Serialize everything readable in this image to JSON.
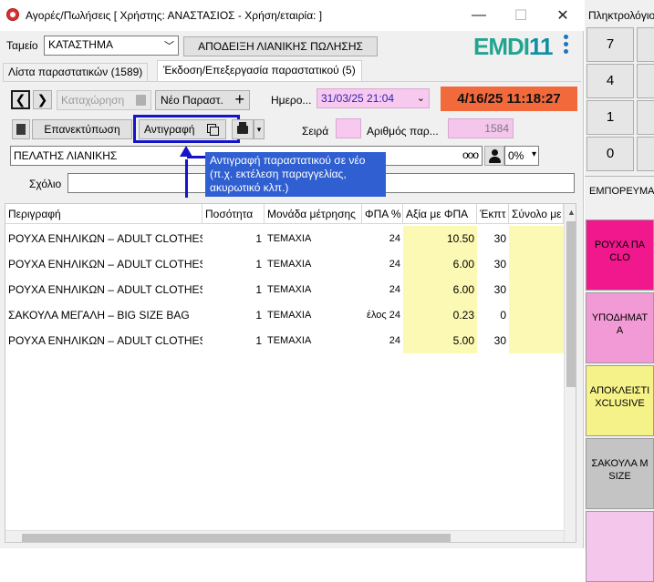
{
  "window": {
    "title": "Αγορές/Πωλήσεις  [ Χρήστης: ΑΝΑΣΤΑΣΙΟΣ - Χρήση/εταιρία:  ]",
    "minimize": "—",
    "maximize": "☐",
    "close": "✕"
  },
  "register": {
    "label": "Ταμείο",
    "value": "ΚΑΤΑΣΤΗΜΑ"
  },
  "doc_type_button": "ΑΠΟΔΕΙΞΗ ΛΙΑΝΙΚΗΣ ΠΩΛΗΣΗΣ",
  "logo": {
    "text": "EMDI",
    "number": "11"
  },
  "tabs": [
    {
      "label": "Λίστα παραστατικών (1589)"
    },
    {
      "label": "Έκδοση/Επεξεργασία παραστατικού (5)"
    }
  ],
  "toolbar": {
    "prev_icon": "❮",
    "next_icon": "❯",
    "save_label": "Καταχώρηση",
    "new_doc_label": "Νέο Παραστ.",
    "new_doc_icon": "+",
    "date_label": "Ημερο...",
    "date_value": "31/03/25 21:04",
    "clock": "4/16/25 11:18:27",
    "reprint_label": "Επανεκτύπωση",
    "copy_label": "Αντιγραφή",
    "print_dropdown": "▾",
    "series_label": "Σειρά",
    "series_value": "",
    "docnum_label": "Αριθμός παρ...",
    "docnum_value": "1584"
  },
  "customer": {
    "value": "ΠΕΛΑΤΗΣ ΛΙΑΝΙΚΗΣ",
    "dots": "ooo",
    "discount": "0%"
  },
  "comment": {
    "label": "Σχόλιο",
    "value": ""
  },
  "tooltip": "Αντιγραφή παραστατικού σε νέο (π.χ. εκτέλεση παραγγελίας, ακυρωτικό κλπ.)",
  "grid": {
    "headers": [
      "Περιγραφή",
      "Ποσότητα",
      "Μονάδα μέτρησης",
      "ΦΠΑ %",
      "Αξία με ΦΠΑ",
      "Έκπτ",
      "Σύνολο με"
    ],
    "rows": [
      [
        "ΡΟΥΧΑ ΕΝΗΛΙΚΩΝ – ADULT CLOTHES",
        "1",
        "ΤΕΜΑΧΙΑ",
        "24",
        "10.50",
        "30",
        ""
      ],
      [
        "ΡΟΥΧΑ ΕΝΗΛΙΚΩΝ – ADULT CLOTHES",
        "1",
        "ΤΕΜΑΧΙΑ",
        "24",
        "6.00",
        "30",
        ""
      ],
      [
        "ΡΟΥΧΑ ΕΝΗΛΙΚΩΝ – ADULT CLOTHES",
        "1",
        "ΤΕΜΑΧΙΑ",
        "24",
        "6.00",
        "30",
        ""
      ],
      [
        "ΣΑΚΟΥΛΑ ΜΕΓΑΛΗ – BIG SIZE BAG",
        "1",
        "ΤΕΜΑΧΙΑ",
        "έλος 24",
        "0.23",
        "0",
        ""
      ],
      [
        "ΡΟΥΧΑ ΕΝΗΛΙΚΩΝ – ADULT CLOTHES",
        "1",
        "ΤΕΜΑΧΙΑ",
        "24",
        "5.00",
        "30",
        ""
      ]
    ]
  },
  "side": {
    "keypad_title": "Πληκτρολόγιο",
    "keys": [
      "7",
      "4",
      "1",
      "0"
    ],
    "products_title": "ΕΜΠΟΡΕΥΜΑΤ",
    "categories": [
      {
        "line1": "ΡΟΥΧΑ ΠΑ",
        "line2": "CLO",
        "color": "#f0188c"
      },
      {
        "line1": "ΥΠΟΔΗΜΑΤ",
        "line2": "Α",
        "color": "#f29ad6"
      },
      {
        "line1": "ΑΠΟΚΛΕΙΣΤΙ",
        "line2": "XCLUSIVE",
        "color": "#f6f28a"
      },
      {
        "line1": "ΣΑΚΟΥΛΑ Μ",
        "line2": "SIZE",
        "color": "#c4c4c4"
      },
      {
        "line1": "",
        "line2": "",
        "color": "#f4c6ec"
      }
    ]
  }
}
